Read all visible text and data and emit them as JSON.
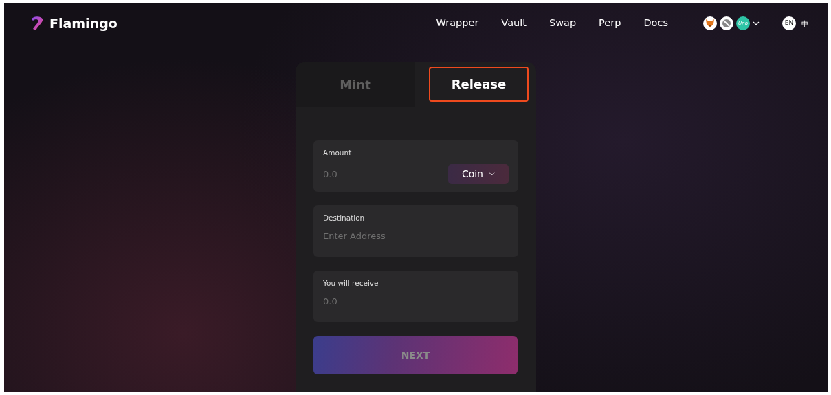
{
  "brand": {
    "name": "Flamingo"
  },
  "nav": [
    {
      "label": "Wrapper"
    },
    {
      "label": "Vault"
    },
    {
      "label": "Swap"
    },
    {
      "label": "Perp"
    },
    {
      "label": "Docs"
    }
  ],
  "wallets": [
    {
      "kind": "fox"
    },
    {
      "kind": "disc"
    },
    {
      "kind": "uno",
      "label": "Uno"
    }
  ],
  "language": {
    "badge": "EN",
    "alt": "中"
  },
  "tabs": [
    {
      "label": "Mint",
      "selected": false
    },
    {
      "label": "Release",
      "selected": true
    }
  ],
  "fields": [
    {
      "kind": "amount",
      "label": "Amount",
      "placeholder": "0.0",
      "token": "Coin"
    },
    {
      "kind": "text",
      "label": "Destination",
      "placeholder": "Enter Address"
    },
    {
      "kind": "readout",
      "label": "You will receive",
      "value": "0.0"
    }
  ],
  "submit": {
    "label": "NEXT",
    "disabled": true
  }
}
